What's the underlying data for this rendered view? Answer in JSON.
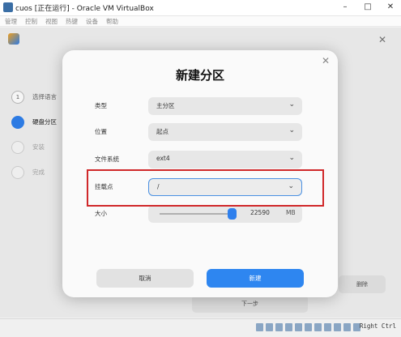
{
  "window": {
    "title": "cuos [正在运行] - Oracle VM VirtualBox",
    "buttons": [
      "–",
      "□",
      "✕"
    ]
  },
  "menubar": [
    "管理",
    "控制",
    "视图",
    "热键",
    "设备",
    "帮助"
  ],
  "installer": {
    "steps": [
      {
        "num": "1",
        "label": "选择语言"
      },
      {
        "num": "",
        "label": "硬盘分区"
      },
      {
        "num": "",
        "label": "安装"
      },
      {
        "num": "",
        "label": "完成"
      }
    ],
    "delete_label": "删除",
    "next_label": "下一步"
  },
  "dialog": {
    "title": "新建分区",
    "fields": {
      "type": {
        "label": "类型",
        "value": "主分区"
      },
      "location": {
        "label": "位置",
        "value": "起点"
      },
      "filesystem": {
        "label": "文件系统",
        "value": "ext4"
      },
      "mountpoint": {
        "label": "挂载点",
        "value": "/"
      },
      "size": {
        "label": "大小",
        "value": "22590",
        "unit": "MB",
        "fill_fraction": 1.0
      }
    },
    "cancel_label": "取消",
    "create_label": "新建"
  },
  "statusbar": {
    "host_key": "Right Ctrl"
  },
  "colors": {
    "accent": "#2e86f0",
    "highlight": "#d0282a"
  }
}
